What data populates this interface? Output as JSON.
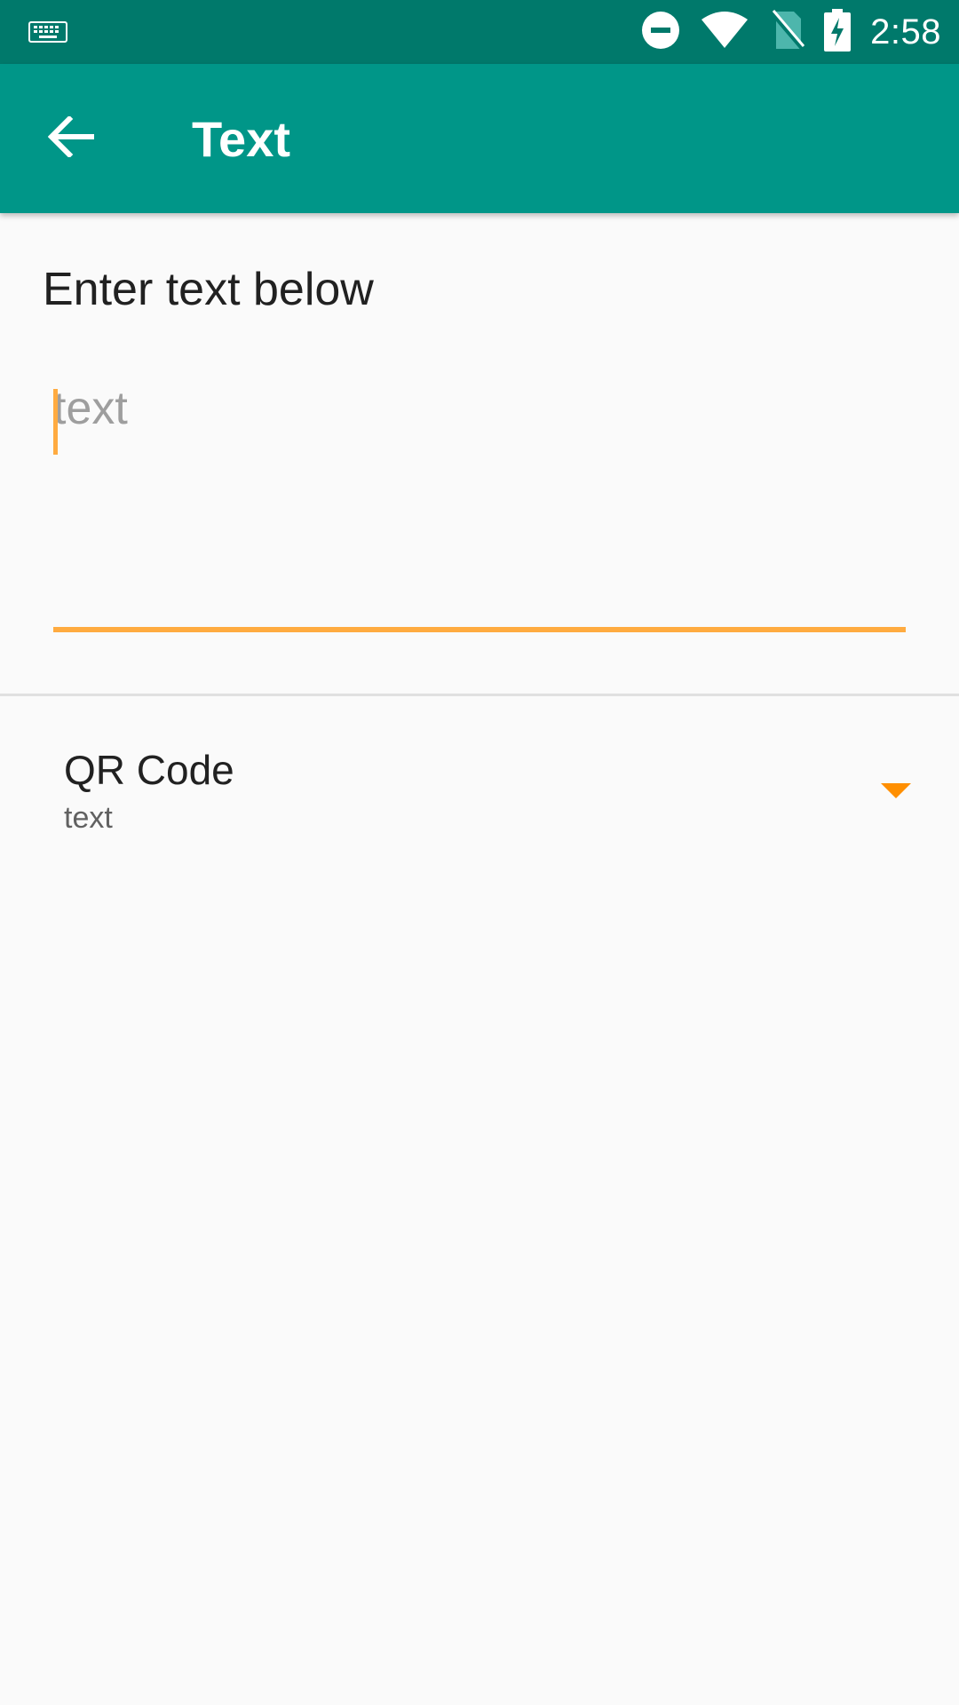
{
  "status_bar": {
    "time": "2:58",
    "icons": [
      "keyboard-icon",
      "do-not-disturb-icon",
      "wifi-icon",
      "no-sim-icon",
      "battery-charging-icon"
    ]
  },
  "app_bar": {
    "title": "Text",
    "back_icon": "arrow-back-icon"
  },
  "form": {
    "prompt": "Enter text below",
    "text_input": {
      "value": "",
      "placeholder": "text"
    }
  },
  "code_type": {
    "label": "QR Code",
    "selected": "text",
    "dropdown_icon": "dropdown-arrow-icon"
  },
  "colors": {
    "status_bar": "#00796b",
    "app_bar": "#009688",
    "accent": "#ffab40",
    "dropdown_arrow": "#ff8f00"
  }
}
